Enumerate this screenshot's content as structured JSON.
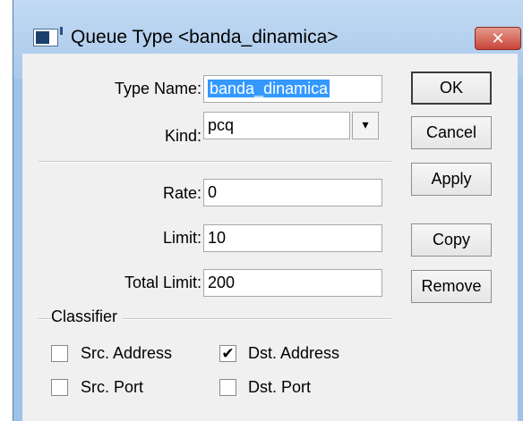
{
  "window": {
    "title": "Queue Type <banda_dinamica>",
    "close_glyph": "✕"
  },
  "form": {
    "type_name_label": "Type Name:",
    "type_name_value": "banda_dinamica",
    "kind_label": "Kind:",
    "kind_value": "pcq",
    "kind_dropdown_glyph": "▾",
    "rate_label": "Rate:",
    "rate_value": "0",
    "limit_label": "Limit:",
    "limit_value": "10",
    "total_limit_label": "Total Limit:",
    "total_limit_value": "200"
  },
  "classifier": {
    "title": "Classifier",
    "items": [
      {
        "label": "Src. Address",
        "checked": false
      },
      {
        "label": "Dst. Address",
        "checked": true
      },
      {
        "label": "Src. Port",
        "checked": false
      },
      {
        "label": "Dst. Port",
        "checked": false
      }
    ]
  },
  "buttons": {
    "ok": "OK",
    "cancel": "Cancel",
    "apply": "Apply",
    "copy": "Copy",
    "remove": "Remove"
  },
  "colors": {
    "titlebar": "#a9c9eb",
    "close_button": "#c9453a",
    "selection": "#3399ff",
    "dialog_background": "#f0f0f0"
  }
}
